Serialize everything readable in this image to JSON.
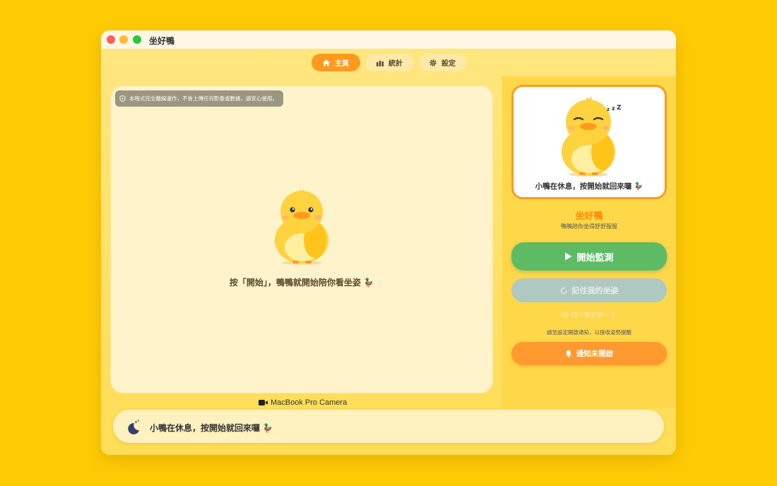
{
  "window": {
    "title": "坐好鴨"
  },
  "tabs": [
    {
      "label": "主頁",
      "icon": "home-icon",
      "active": true
    },
    {
      "label": "統計",
      "icon": "bar-chart-icon",
      "active": false
    },
    {
      "label": "設定",
      "icon": "gear-icon",
      "active": false
    }
  ],
  "camera": {
    "privacy_notice": "本程式完全離線運作，不會上傳任何影像或數據，請安心使用。",
    "prompt": "按「開始」，鴨鴨就開始陪你看坐姿 🦆",
    "device_label": "MacBook Pro Camera"
  },
  "status": {
    "text": "小鴨在休息，按開始就回來囉 🦆",
    "icon": "moon-sleep-icon"
  },
  "sidebar": {
    "preview_caption": "小鴨在休息，按開始就回來囉 🦆",
    "app_name": "坐好鴨",
    "tagline": "鴨鴨陪你坐得舒舒服服",
    "start_button": "開始監測",
    "record_button": "記住我的坐姿",
    "disabled_hint": "請小鴨安靜一下",
    "notification_hint": "請至設定開啟通知，以接收姿勢提醒",
    "notify_button": "通知未開啟"
  },
  "colors": {
    "background": "#FFCB05",
    "accent": "#FF9A1F",
    "start_green": "#5CBB64",
    "notify_orange": "#FF9A30",
    "duck_yellow": "#FFD23F"
  }
}
